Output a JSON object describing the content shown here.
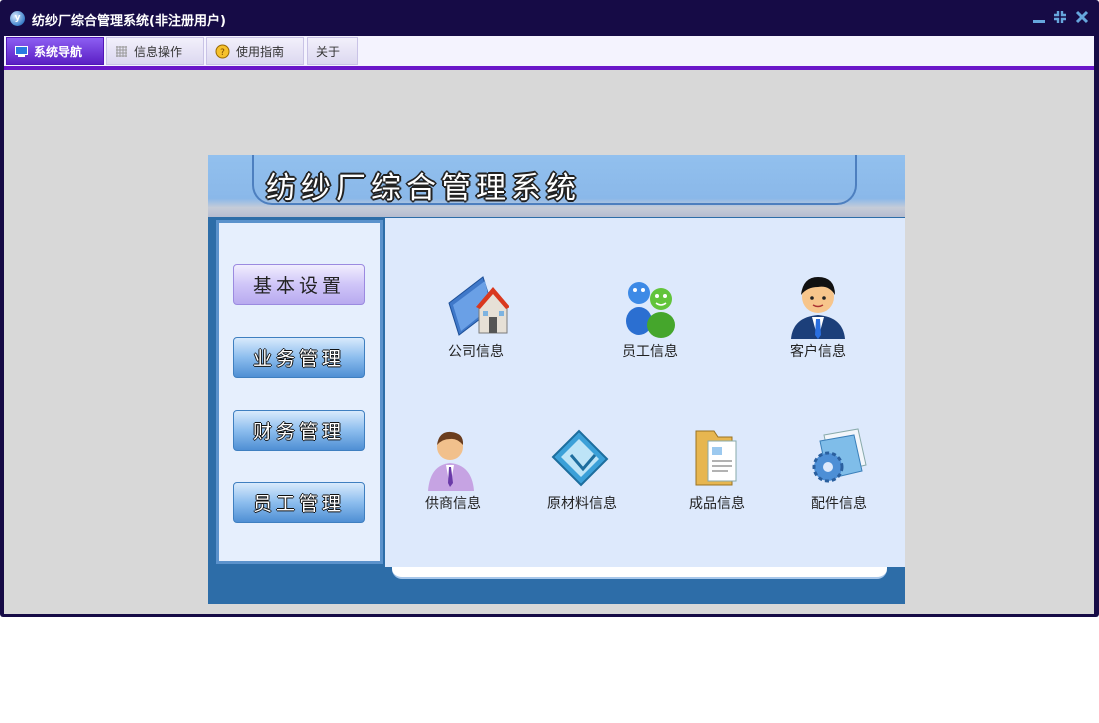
{
  "window": {
    "title": "纺纱厂综合管理系统(非注册用户)",
    "controls": [
      "minimize",
      "restore",
      "close"
    ]
  },
  "menu": {
    "tabs": [
      {
        "label": "系统导航",
        "icon": "monitor-icon",
        "active": true
      },
      {
        "label": "信息操作",
        "icon": "grid-icon",
        "active": false
      },
      {
        "label": "使用指南",
        "icon": "help-icon",
        "active": false
      },
      {
        "label": "关于",
        "icon": "",
        "active": false
      }
    ]
  },
  "banner": {
    "title": "纺纱厂综合管理系统"
  },
  "sidebar": {
    "buttons": [
      {
        "label": "基本设置",
        "selected": true
      },
      {
        "label": "业务管理",
        "selected": false
      },
      {
        "label": "财务管理",
        "selected": false
      },
      {
        "label": "员工管理",
        "selected": false
      }
    ]
  },
  "items": [
    {
      "label": "公司信息",
      "icon": "company-icon"
    },
    {
      "label": "员工信息",
      "icon": "employees-icon"
    },
    {
      "label": "客户信息",
      "icon": "customer-icon"
    },
    {
      "label": "供商信息",
      "icon": "supplier-icon"
    },
    {
      "label": "原材料信息",
      "icon": "raw-material-icon"
    },
    {
      "label": "成品信息",
      "icon": "product-icon"
    },
    {
      "label": "配件信息",
      "icon": "parts-icon"
    }
  ],
  "colors": {
    "titlebar": "#160b46",
    "menu_accent": "#6a16c9",
    "content_bg": "#d8d8d8",
    "panel_bg": "#2d6da8",
    "main_bg": "#dde9fc"
  }
}
